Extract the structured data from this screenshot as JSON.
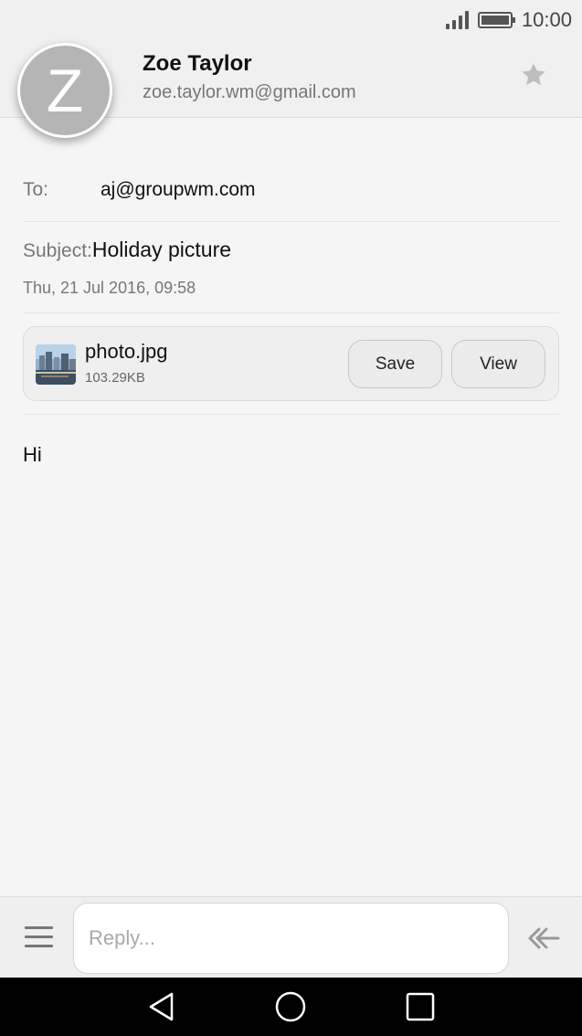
{
  "status_bar": {
    "time": "10:00"
  },
  "header": {
    "avatar_letter": "Z",
    "sender_name": "Zoe Taylor",
    "sender_email": "zoe.taylor.wm@gmail.com"
  },
  "email": {
    "to_label": "To:",
    "to_value": "aj@groupwm.com",
    "subject_label": "Subject:",
    "subject_value": "Holiday picture",
    "date": "Thu, 21 Jul 2016, 09:58",
    "body": "Hi"
  },
  "attachment": {
    "name": "photo.jpg",
    "size": "103.29KB",
    "save_label": "Save",
    "view_label": "View"
  },
  "reply_bar": {
    "placeholder": "Reply..."
  },
  "colors": {
    "avatar": "#b5b5b5",
    "background": "#f5f5f5",
    "nav_bar": "#000000"
  },
  "icons": [
    "signal-icon",
    "battery-icon",
    "star-icon",
    "attachment-thumbnail",
    "menu-icon",
    "reply-all-icon",
    "back-icon",
    "home-icon",
    "recents-icon"
  ]
}
